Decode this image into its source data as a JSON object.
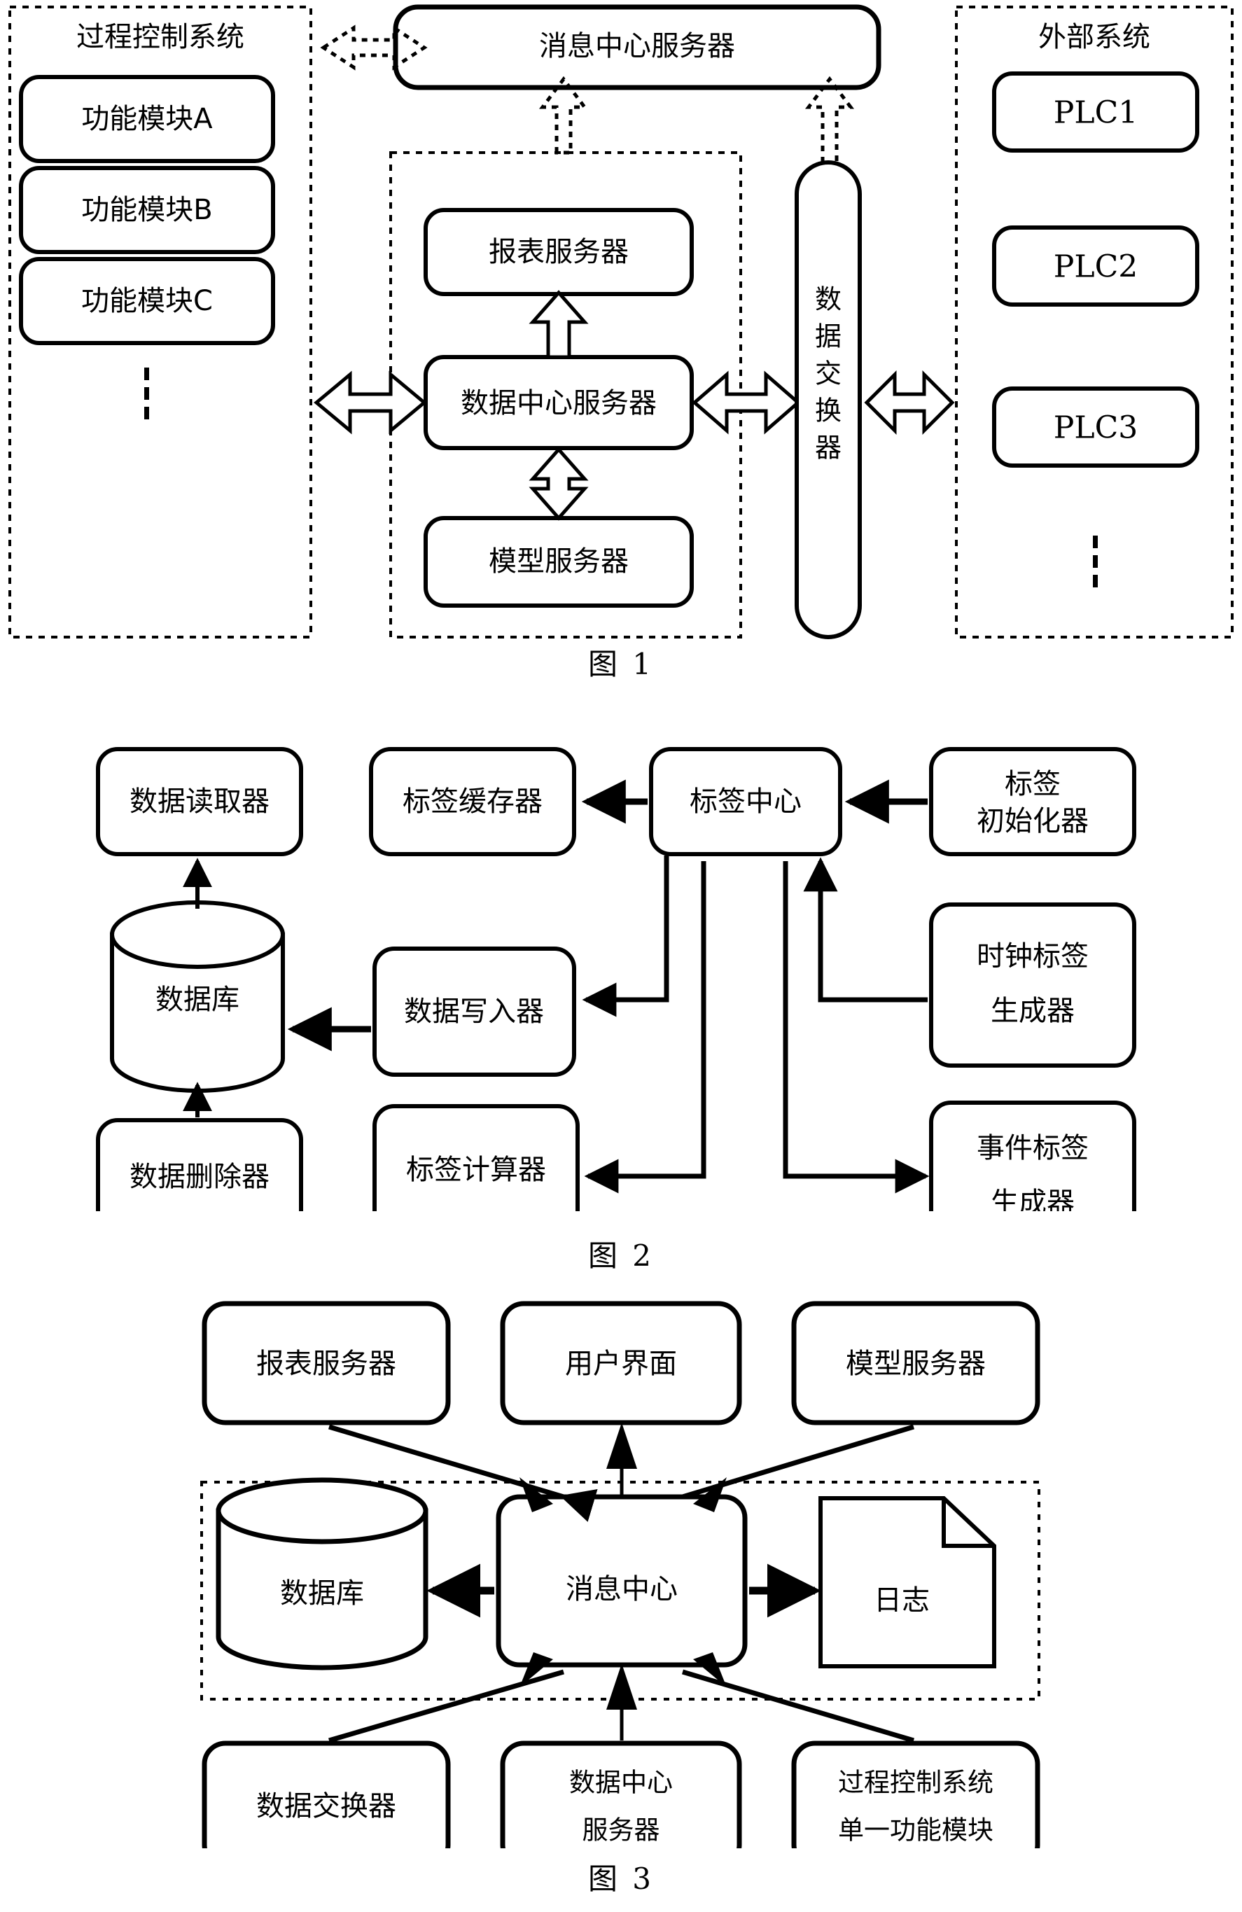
{
  "document": {
    "kind": "patent-figure-sheet",
    "figures": [
      "fig1",
      "fig2",
      "fig3"
    ]
  },
  "fig1": {
    "caption": "图 1",
    "groups": {
      "process_control_system": {
        "title": "过程控制系统",
        "modules": [
          "功能模块A",
          "功能模块B",
          "功能模块C"
        ],
        "ellipsis": "⋮"
      },
      "data_center": {
        "nodes": [
          "报表服务器",
          "数据中心服务器",
          "模型服务器"
        ]
      },
      "external_system": {
        "title": "外部系统",
        "modules": [
          "PLC1",
          "PLC2",
          "PLC3"
        ],
        "ellipsis": "⋮"
      }
    },
    "message_center_server": "消息中心服务器",
    "data_exchanger": "数据交换器",
    "data_exchanger_chars": [
      "数",
      "据",
      "交",
      "换",
      "器"
    ]
  },
  "fig2": {
    "caption": "图 2",
    "nodes": {
      "data_reader": "数据读取器",
      "tag_cache": "标签缓存器",
      "tag_center": "标签中心",
      "tag_initializer_l1": "标签",
      "tag_initializer_l2": "初始化器",
      "database": "数据库",
      "data_writer": "数据写入器",
      "clock_tag_generator_l1": "时钟标签",
      "clock_tag_generator_l2": "生成器",
      "data_deleter": "数据删除器",
      "tag_calculator": "标签计算器",
      "event_tag_generator_l1": "事件标签",
      "event_tag_generator_l2": "生成器"
    }
  },
  "fig3": {
    "caption": "图 3",
    "nodes": {
      "report_server": "报表服务器",
      "user_interface": "用户界面",
      "model_server": "模型服务器",
      "database": "数据库",
      "message_center": "消息中心",
      "log": "日志",
      "data_exchanger": "数据交换器",
      "data_center_server_l1": "数据中心",
      "data_center_server_l2": "服务器",
      "pcs_single_module_l1": "过程控制系统",
      "pcs_single_module_l2": "单一功能模块"
    }
  },
  "colors": {
    "stroke": "#000000",
    "fill": "#ffffff"
  }
}
